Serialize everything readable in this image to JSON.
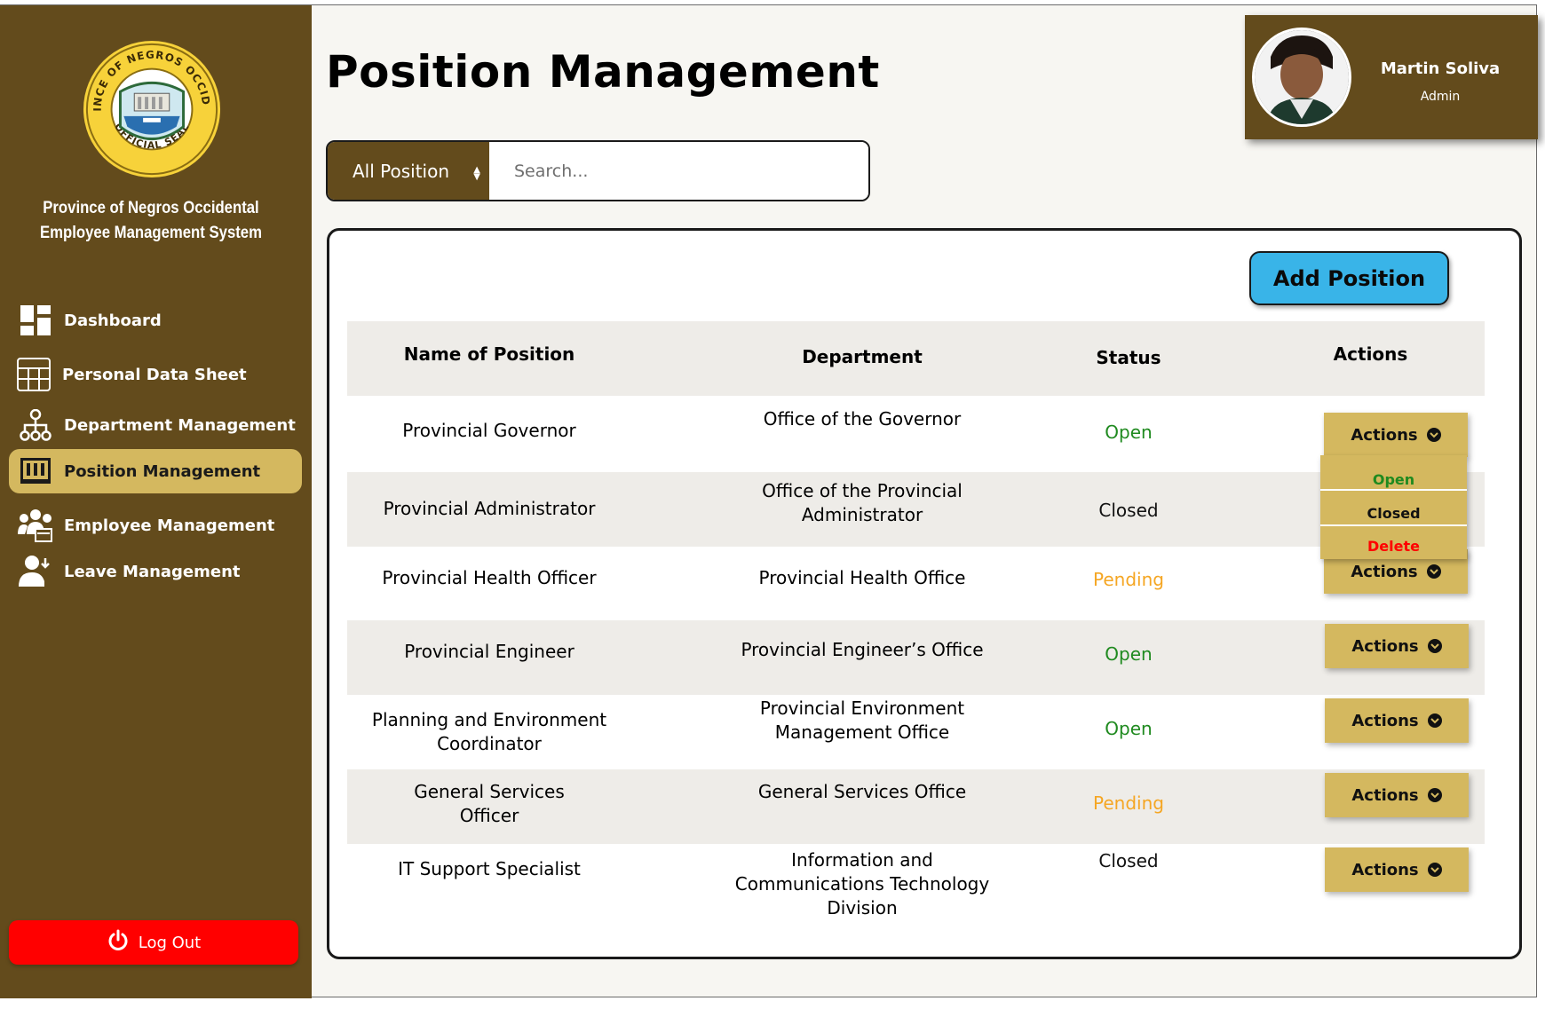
{
  "sidebar": {
    "org_line1": "Province of Negros Occidental",
    "org_line2": "Employee Management System",
    "seal_text_top": "PROVINCE OF NEGROS OCCIDENTAL",
    "seal_text_bottom": "OFFICIAL SEAL",
    "items": [
      {
        "label": "Dashboard",
        "icon": "dashboard-icon"
      },
      {
        "label": "Personal Data Sheet",
        "icon": "grid-sheet-icon"
      },
      {
        "label": "Department Management",
        "icon": "org-chart-icon"
      },
      {
        "label": "Position Management",
        "icon": "position-board-icon",
        "active": true
      },
      {
        "label": "Employee Management",
        "icon": "employees-icon"
      },
      {
        "label": "Leave Management",
        "icon": "leave-user-icon"
      }
    ],
    "logout_label": "Log Out"
  },
  "header": {
    "title": "Position Management"
  },
  "profile": {
    "name": "Martin Soliva",
    "role": "Admin"
  },
  "filter": {
    "selected": "All Position",
    "search_placeholder": "Search..."
  },
  "panel": {
    "add_label": "Add Position"
  },
  "table": {
    "headers": [
      "Name of Position",
      "Department",
      "Status",
      "Actions"
    ],
    "rows": [
      {
        "name": "Provincial Governor",
        "department": "Office of the Governor",
        "status": "Open",
        "action": "Actions"
      },
      {
        "name": "Provincial Administrator",
        "department_line1": "Office of the Provincial",
        "department_line2": "Administrator",
        "status": "Closed",
        "action": "Actions"
      },
      {
        "name": "Provincial Health Officer",
        "department": "Provincial Health Office",
        "status": "Pending",
        "action": "Actions"
      },
      {
        "name": "Provincial Engineer",
        "department": "Provincial Engineer’s Office",
        "status": "Open",
        "action": "Actions"
      },
      {
        "name_line1": "Planning and Environment",
        "name_line2": "Coordinator",
        "department_line1": "Provincial Environment",
        "department_line2": "Management Office",
        "status": "Open",
        "action": "Actions"
      },
      {
        "name_line1": "General Services",
        "name_line2": "Officer",
        "department": "General Services Office",
        "status": "Pending",
        "action": "Actions"
      },
      {
        "name": "IT Support Specialist",
        "department_line1": "Information and",
        "department_line2": "Communications Technology",
        "department_line3": "Division",
        "status": "Closed",
        "action": "Actions"
      }
    ]
  },
  "dropdown": {
    "open": "Open",
    "closed": "Closed",
    "delete": "Delete"
  },
  "colors": {
    "sidebar": "#634b1c",
    "gold": "#d4b85f",
    "add_button": "#39b4e8",
    "logout": "#ff0000",
    "open": "#1f8a1f",
    "pending": "#f5a623",
    "delete": "#ff0000"
  }
}
